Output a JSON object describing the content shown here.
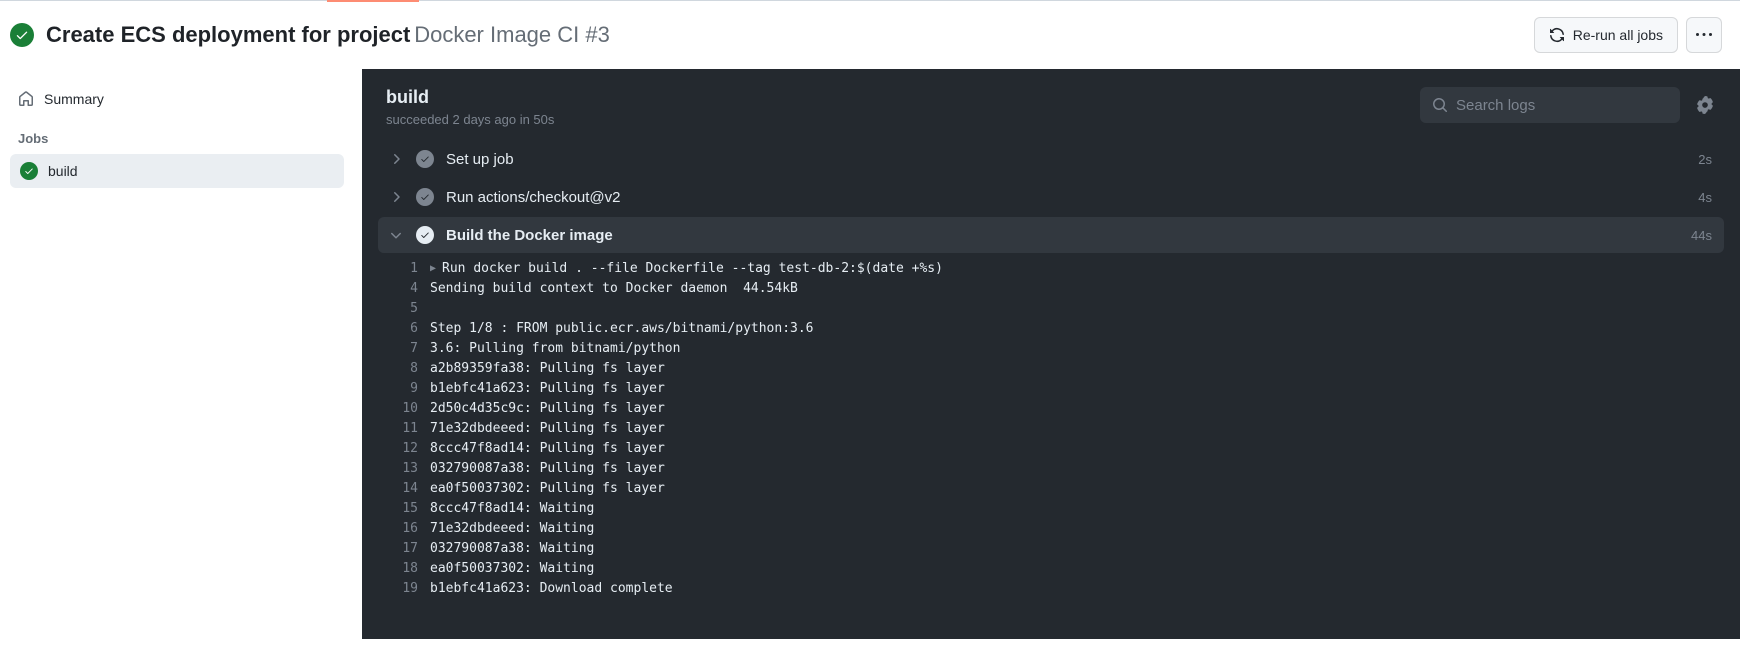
{
  "header": {
    "title": "Create ECS deployment for project",
    "subtitle": "Docker Image CI #3",
    "rerun_label": "Re-run all jobs"
  },
  "sidebar": {
    "summary_label": "Summary",
    "jobs_label": "Jobs",
    "jobs": [
      {
        "name": "build"
      }
    ]
  },
  "job": {
    "name": "build",
    "status_text": "succeeded 2 days ago in 50s",
    "search_placeholder": "Search logs"
  },
  "steps": [
    {
      "name": "Set up job",
      "duration": "2s",
      "expanded": false
    },
    {
      "name": "Run actions/checkout@v2",
      "duration": "4s",
      "expanded": false
    },
    {
      "name": "Build the Docker image",
      "duration": "44s",
      "expanded": true
    }
  ],
  "log": [
    {
      "n": 1,
      "caret": true,
      "text": "Run docker build . --file Dockerfile --tag test-db-2:$(date +%s)"
    },
    {
      "n": 4,
      "text": "Sending build context to Docker daemon  44.54kB"
    },
    {
      "n": 5,
      "text": ""
    },
    {
      "n": 6,
      "text": "Step 1/8 : FROM public.ecr.aws/bitnami/python:3.6"
    },
    {
      "n": 7,
      "text": "3.6: Pulling from bitnami/python"
    },
    {
      "n": 8,
      "text": "a2b89359fa38: Pulling fs layer"
    },
    {
      "n": 9,
      "text": "b1ebfc41a623: Pulling fs layer"
    },
    {
      "n": 10,
      "text": "2d50c4d35c9c: Pulling fs layer"
    },
    {
      "n": 11,
      "text": "71e32dbdeeed: Pulling fs layer"
    },
    {
      "n": 12,
      "text": "8ccc47f8ad14: Pulling fs layer"
    },
    {
      "n": 13,
      "text": "032790087a38: Pulling fs layer"
    },
    {
      "n": 14,
      "text": "ea0f50037302: Pulling fs layer"
    },
    {
      "n": 15,
      "text": "8ccc47f8ad14: Waiting"
    },
    {
      "n": 16,
      "text": "71e32dbdeeed: Waiting"
    },
    {
      "n": 17,
      "text": "032790087a38: Waiting"
    },
    {
      "n": 18,
      "text": "ea0f50037302: Waiting"
    },
    {
      "n": 19,
      "text": "b1ebfc41a623: Download complete"
    }
  ]
}
